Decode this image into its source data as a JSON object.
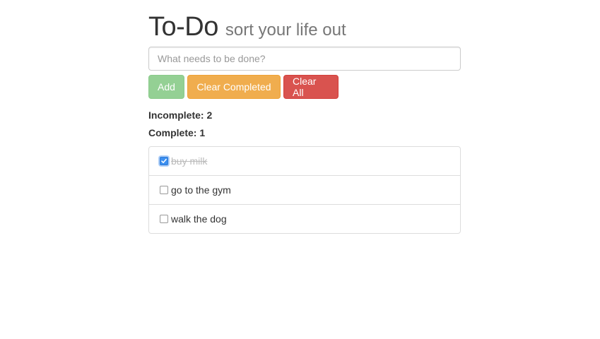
{
  "header": {
    "title": "To-Do",
    "subtitle": "sort your life out"
  },
  "new_todo": {
    "value": "",
    "placeholder": "What needs to be done?"
  },
  "buttons": {
    "add_label": "Add",
    "clear_completed_label": "Clear Completed",
    "clear_all_label": "Clear All"
  },
  "stats": {
    "incomplete_label": "Incomplete:",
    "incomplete_count": "2",
    "complete_label": "Complete:",
    "complete_count": "1"
  },
  "todos": [
    {
      "text": "buy milk",
      "completed": true
    },
    {
      "text": "go to the gym",
      "completed": false
    },
    {
      "text": "walk the dog",
      "completed": false
    }
  ],
  "colors": {
    "add": "#5cb85c",
    "clear_completed": "#f0ad4e",
    "clear_all": "#d9534f",
    "checkbox_checked": "#3b8ff0"
  }
}
